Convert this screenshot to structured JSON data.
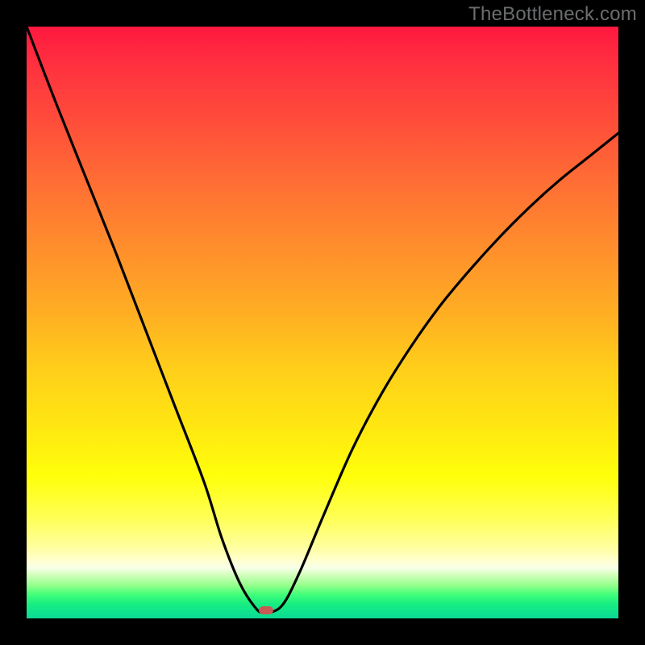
{
  "watermark": "TheBottleneck.com",
  "colors": {
    "frame_bg": "#000000",
    "curve_stroke": "#000000",
    "marker_fill": "#c85a55"
  },
  "chart_data": {
    "type": "line",
    "title": "",
    "xlabel": "",
    "ylabel": "",
    "xlim": [
      0,
      100
    ],
    "ylim": [
      0,
      100
    ],
    "grid": false,
    "legend": false,
    "annotations": [
      "TheBottleneck.com"
    ],
    "series": [
      {
        "name": "curve",
        "x": [
          0,
          5,
          10,
          15,
          20,
          25,
          30,
          33,
          36,
          38.5,
          40,
          43,
          46,
          50,
          55,
          60,
          65,
          70,
          75,
          80,
          85,
          90,
          95,
          100
        ],
        "y": [
          100,
          87,
          74.5,
          62,
          49,
          36,
          23,
          13.5,
          6,
          2,
          1,
          2,
          7.5,
          17,
          28.5,
          38,
          46,
          53,
          59,
          64.5,
          69.5,
          74,
          78,
          82
        ]
      }
    ],
    "marker": {
      "x": 40.5,
      "y": 1.3
    },
    "background_gradient_stops": [
      {
        "pos": 0.0,
        "color": "#ff183f"
      },
      {
        "pos": 0.25,
        "color": "#ff6a35"
      },
      {
        "pos": 0.58,
        "color": "#ffcf1a"
      },
      {
        "pos": 0.76,
        "color": "#ffff0b"
      },
      {
        "pos": 0.9,
        "color": "#ffffd6"
      },
      {
        "pos": 0.96,
        "color": "#40ff7a"
      },
      {
        "pos": 1.0,
        "color": "#0cd893"
      }
    ]
  }
}
